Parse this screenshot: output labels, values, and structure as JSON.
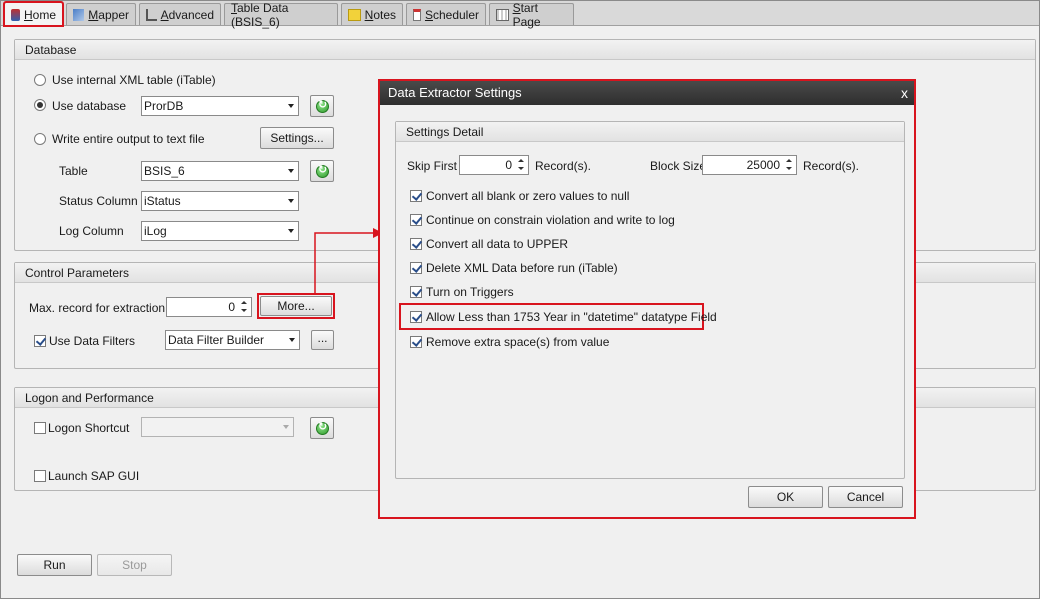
{
  "tabs": [
    {
      "label": "Home",
      "icon": "home-icon"
    },
    {
      "label": "Mapper",
      "icon": "mapper-icon"
    },
    {
      "label": "Advanced",
      "icon": "advanced-icon"
    },
    {
      "label": "Table Data (BSIS_6)",
      "icon": ""
    },
    {
      "label": "Notes",
      "icon": "notes-icon"
    },
    {
      "label": "Scheduler",
      "icon": "scheduler-icon"
    },
    {
      "label": "Start Page",
      "icon": "start-page-icon"
    }
  ],
  "database": {
    "title": "Database",
    "opt_internal": "Use internal XML table (iTable)",
    "opt_database": "Use  database",
    "database_value": "ProrDB",
    "opt_text": "Write entire output to text file",
    "settings_btn": "Settings...",
    "table_label": "Table",
    "table_value": "BSIS_6",
    "status_label": "Status Column",
    "status_value": "iStatus",
    "log_label": "Log Column",
    "log_value": "iLog"
  },
  "control": {
    "title": "Control Parameters",
    "max_label": "Max. record for extraction",
    "max_value": "0",
    "more_btn": "More...",
    "filters_label": "Use Data Filters",
    "filters_value": "Data Filter Builder",
    "ellipsis_btn": "..."
  },
  "logon": {
    "title": "Logon and Performance",
    "shortcut_label": "Logon Shortcut",
    "shortcut_value": "",
    "sapgui_label": "Launch SAP GUI"
  },
  "footer": {
    "run": "Run",
    "stop": "Stop"
  },
  "dialog": {
    "title": "Data Extractor Settings",
    "close": "x",
    "group_title": "Settings Detail",
    "skip_label": "Skip First",
    "skip_value": "0",
    "records1": "Record(s).",
    "block_label": "Block Size",
    "block_value": "25000",
    "records2": "Record(s).",
    "options": [
      "Convert all blank or zero values to null",
      "Continue on constrain violation and write to log",
      "Convert all data to UPPER",
      "Delete XML Data before run (iTable)",
      "Turn on Triggers",
      "Allow Less than 1753 Year in \"datetime\" datatype Field",
      "Remove extra space(s) from value"
    ],
    "ok": "OK",
    "cancel": "Cancel"
  },
  "colors": {
    "highlight": "#d8141e",
    "title_bar": "#3a3a3a",
    "refresh_green": "#2d9a2a"
  }
}
